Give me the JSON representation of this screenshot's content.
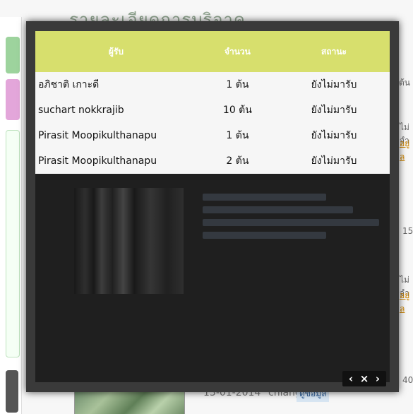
{
  "background": {
    "page_title": "รายละเอียดการบริจาค",
    "right_snippets": [
      "ต้น",
      "ไม่จำ",
      "อยู่ล",
      "15",
      "ไม่จำ",
      "อยู่ล",
      "40"
    ],
    "bottom_date": "13-01-2014",
    "bottom_location": "chiangmai",
    "bottom_more": "ดูข้อมูล"
  },
  "modal": {
    "table": {
      "headers": [
        "ผู้รับ",
        "จำนวน",
        "สถานะ"
      ],
      "rows": [
        {
          "recipient": "อภิชาติ เกาะดี",
          "quantity": "1 ต้น",
          "status": "ยังไม่มารับ"
        },
        {
          "recipient": "suchart nokkrajib",
          "quantity": "10 ต้น",
          "status": "ยังไม่มารับ"
        },
        {
          "recipient": "Pirasit Moopikulthanapu",
          "quantity": "1 ต้น",
          "status": "ยังไม่มารับ"
        },
        {
          "recipient": "Pirasit Moopikulthanapu",
          "quantity": "2 ต้น",
          "status": "ยังไม่มารับ"
        }
      ]
    },
    "controls": {
      "prev_icon": "‹",
      "close_icon": "×",
      "next_icon": "›"
    }
  },
  "colors": {
    "header_bg": "#d7df6d",
    "overlay_bg": "#1f1f1f",
    "frame_bg": "#3a3a3a"
  }
}
